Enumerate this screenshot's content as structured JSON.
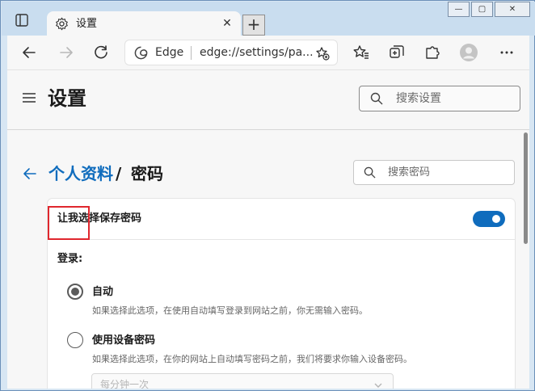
{
  "tab": {
    "title": "设置",
    "close": "✕"
  },
  "newtab": {
    "label": "+"
  },
  "window": {
    "minimize": "—",
    "maximize": "▢",
    "close": "✕"
  },
  "address": {
    "brand": "Edge",
    "url": "edge://settings/pa..."
  },
  "header": {
    "title": "设置",
    "search_placeholder": "搜索设置"
  },
  "breadcrumb": {
    "parent": "个人资料",
    "separator": "/",
    "current": "密码"
  },
  "password_search": {
    "placeholder": "搜索密码"
  },
  "card": {
    "offer_save_label": "让我选择保存密码",
    "offer_save_enabled": true,
    "login_label": "登录:",
    "options": [
      {
        "title": "自动",
        "desc": "如果选择此选项，在使用自动填写登录到网站之前，你无需输入密码。",
        "selected": true
      },
      {
        "title": "使用设备密码",
        "desc": "如果选择此选项，在你的网站上自动填写密码之前，我们将要求你输入设备密码。",
        "selected": false
      }
    ],
    "frequency_value": "每分钟一次"
  },
  "colors": {
    "accent": "#0f6cbd",
    "highlight": "#e0272e"
  },
  "icons": [
    "tab-actions-icon",
    "gear-icon",
    "back-icon",
    "forward-icon",
    "refresh-icon",
    "edge-icon",
    "add-favorite-icon",
    "favorites-icon",
    "collections-icon",
    "extensions-icon",
    "profile-icon",
    "more-icon",
    "hamburger-icon",
    "search-icon",
    "back-arrow-icon",
    "chevron-down-icon"
  ]
}
